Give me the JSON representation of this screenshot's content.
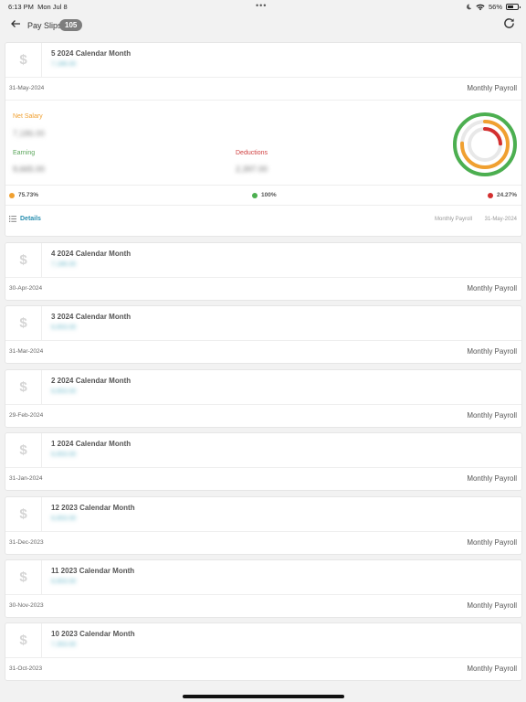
{
  "status": {
    "time": "6:13 PM",
    "date": "Mon Jul 8",
    "battery": "56%"
  },
  "header": {
    "title": "Pay Slips",
    "count": "105"
  },
  "first": {
    "month": "5 2024 Calendar Month",
    "amount": "7,186.00",
    "date": "31-May-2024",
    "type": "Monthly Payroll",
    "net_label": "Net Salary",
    "net_value": "7,186.00",
    "earning_label": "Earning",
    "earning_value": "9,665.00",
    "deductions_label": "Deductions",
    "deductions_value": "2,397.00",
    "pct_net": "75.73%",
    "pct_total": "100%",
    "pct_deductions": "24.27%",
    "details_label": "Details",
    "details_type": "Monthly Payroll",
    "details_date": "31-May-2024",
    "ring": {
      "net": 75.73,
      "deductions": 24.27,
      "total": 100
    },
    "colors": {
      "net": "#f0a030",
      "total": "#4caf50",
      "deductions": "#d32f2f"
    }
  },
  "slips": [
    {
      "month": "4 2024 Calendar Month",
      "amount": "7,186.00",
      "date": "30-Apr-2024",
      "type": "Monthly Payroll"
    },
    {
      "month": "3 2024 Calendar Month",
      "amount": "6,653.00",
      "date": "31-Mar-2024",
      "type": "Monthly Payroll"
    },
    {
      "month": "2 2024 Calendar Month",
      "amount": "6,653.00",
      "date": "29-Feb-2024",
      "type": "Monthly Payroll"
    },
    {
      "month": "1 2024 Calendar Month",
      "amount": "6,653.00",
      "date": "31-Jan-2024",
      "type": "Monthly Payroll"
    },
    {
      "month": "12 2023 Calendar Month",
      "amount": "6,653.00",
      "date": "31-Dec-2023",
      "type": "Monthly Payroll"
    },
    {
      "month": "11 2023 Calendar Month",
      "amount": "6,653.00",
      "date": "30-Nov-2023",
      "type": "Monthly Payroll"
    },
    {
      "month": "10 2023 Calendar Month",
      "amount": "7,353.00",
      "date": "31-Oct-2023",
      "type": "Monthly Payroll"
    }
  ]
}
